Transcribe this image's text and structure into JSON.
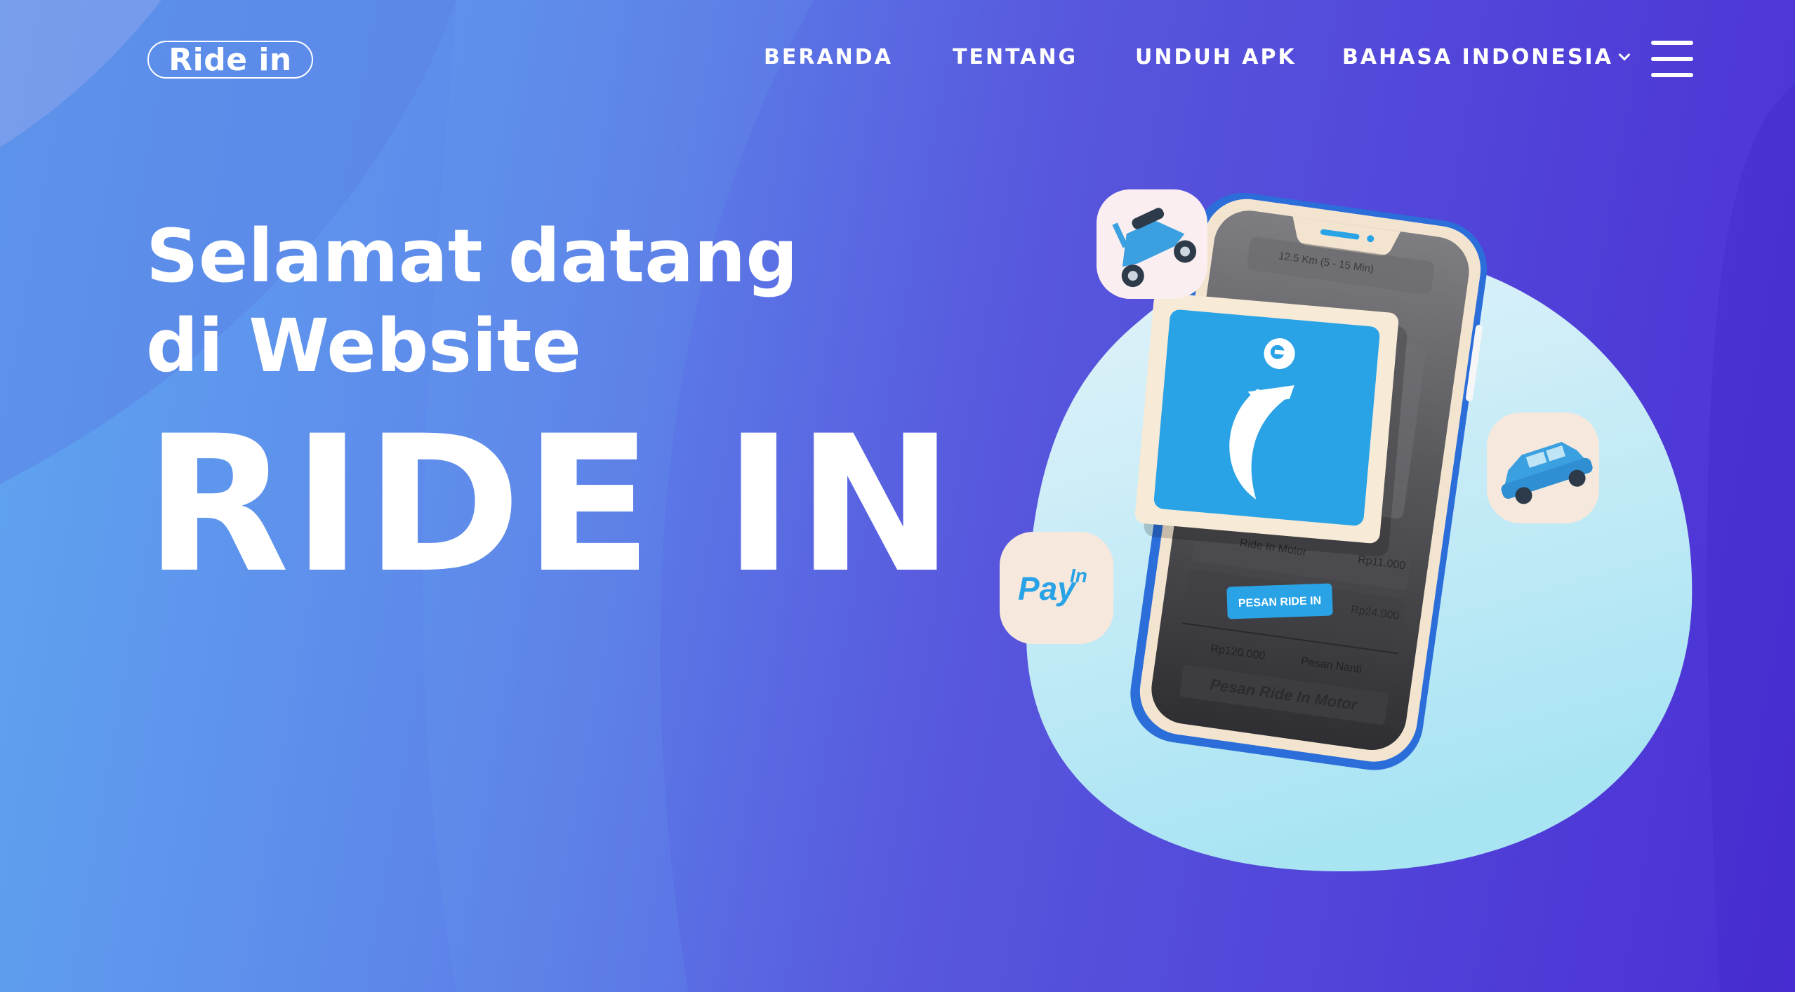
{
  "header": {
    "logo_text": "Ride in",
    "nav": {
      "home": "BERANDA",
      "about": "TENTANG",
      "download": "UNDUH APK",
      "language": "BAHASA INDONESIA"
    }
  },
  "hero": {
    "line1": "Selamat datang",
    "line2": "di Website",
    "brand": "RIDE IN"
  },
  "illustration": {
    "pay_badge": {
      "main": "Pay",
      "super": "In"
    },
    "order_button_label": "PESAN RIDE IN",
    "phone_header": "12.5 Km (5 - 15 Min)",
    "row1_title": "Ride In Motor",
    "row1_price": "Rp11.000",
    "row2_price": "Rp24.000",
    "payment_amount": "Rp120.000",
    "payment_note": "Pesan Nanti",
    "bottom_button": "Pesan Ride In Motor"
  },
  "colors": {
    "brand_blue": "#2aa3e6",
    "card_cream": "#f6ead6",
    "bg_purple": "#4b2fd4",
    "bg_blue": "#5fa6f0"
  }
}
